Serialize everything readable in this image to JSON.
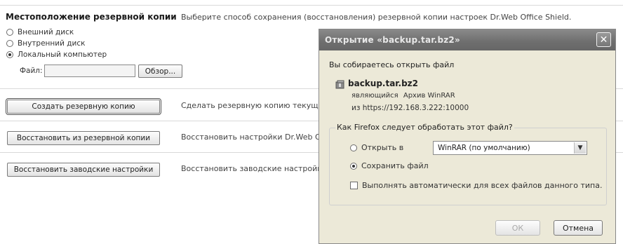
{
  "backup_location": {
    "title": "Местоположение резервной копии",
    "description": "Выберите способ сохранения (восстановления) резервной копии настроек Dr.Web Office Shield.",
    "options": [
      {
        "label": "Внешний диск",
        "checked": false
      },
      {
        "label": "Внутренний диск",
        "checked": false
      },
      {
        "label": "Локальный компьютер",
        "checked": true
      }
    ],
    "file_label": "Файл:",
    "file_value": "",
    "browse_label": "Обзор..."
  },
  "actions": [
    {
      "button": "Создать резервную копию",
      "description": "Сделать резервную копию текущих"
    },
    {
      "button": "Восстановить из резервной копии",
      "description": "Восстановить настройки Dr.Web Off"
    },
    {
      "button": "Восстановить заводские настройки",
      "description": "Восстановить заводские настройки"
    }
  ],
  "dialog": {
    "title": "Открытие «backup.tar.bz2»",
    "close_symbol": "✕",
    "intro": "Вы собираетесь открыть файл",
    "filename": "backup.tar.bz2",
    "type_prefix": "являющийся",
    "type_value": "Архив WinRAR",
    "from_text": "из https://192.168.3.222:10000",
    "question": "Как Firefox следует обработать этот файл?",
    "open_with_label": "Открыть в",
    "open_with_value": "WinRAR (по умолчанию)",
    "save_label": "Сохранить файл",
    "auto_label": "Выполнять автоматически для всех файлов данного типа.",
    "ok_label": "ОК",
    "cancel_label": "Отмена"
  },
  "icons": {
    "file": "archive-file-icon",
    "dropdown": "chevron-down-icon",
    "close": "close-icon"
  }
}
